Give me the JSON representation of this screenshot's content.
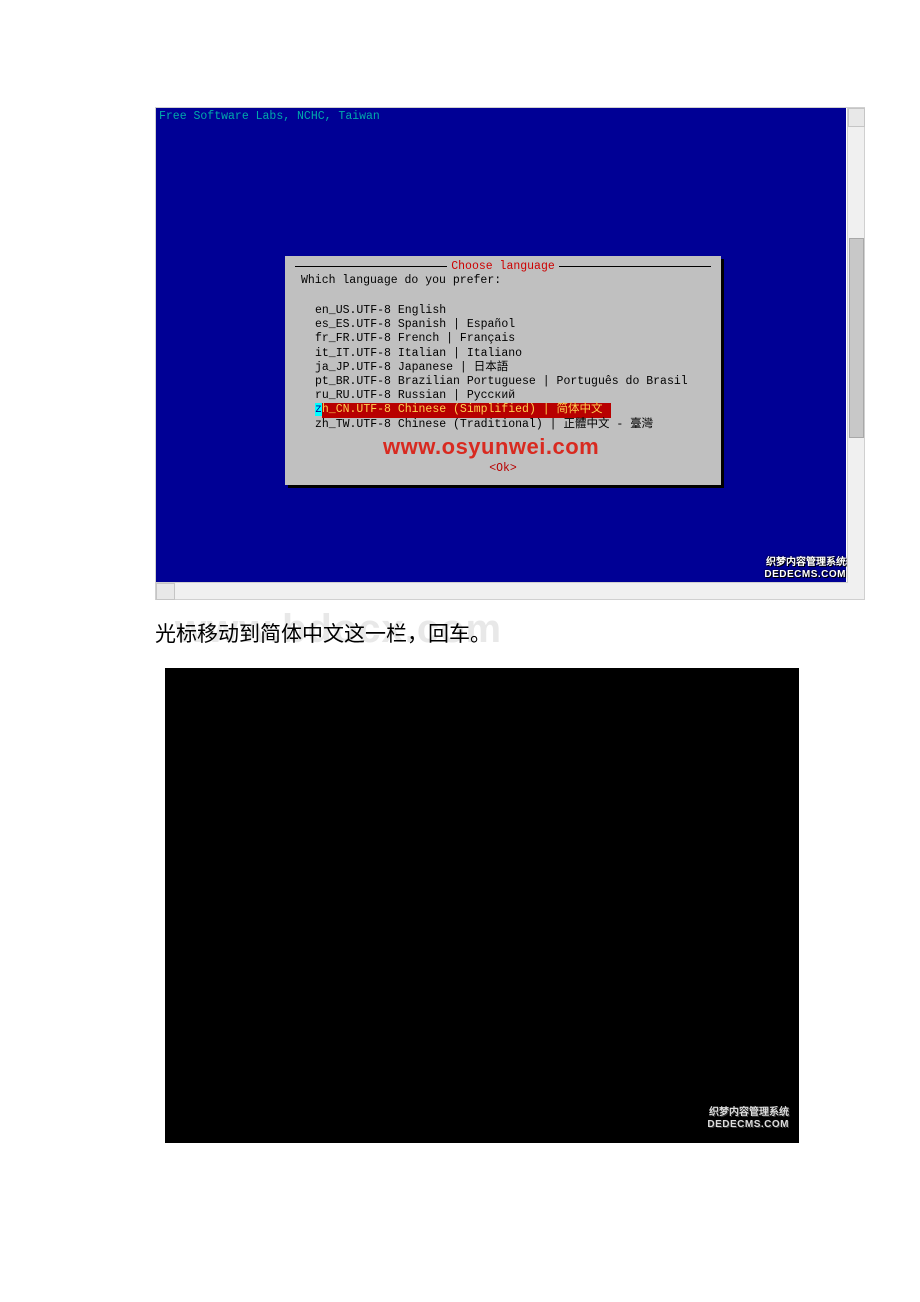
{
  "screenshot1": {
    "header": "Free Software Labs, NCHC, Taiwan",
    "dialog_title": "Choose language",
    "prompt": "Which language do you prefer:",
    "languages": [
      "en_US.UTF-8 English",
      "es_ES.UTF-8 Spanish | Español",
      "fr_FR.UTF-8 French | Français",
      "it_IT.UTF-8 Italian | Italiano",
      "ja_JP.UTF-8 Japanese | 日本語",
      "pt_BR.UTF-8 Brazilian Portuguese | Português do Brasil",
      "ru_RU.UTF-8 Russian | Русский",
      "zh_CN.UTF-8 Chinese (Simplified) | 简体中文",
      "zh_TW.UTF-8 Chinese (Traditional) | 正體中文 - 臺灣"
    ],
    "selected_index": 7,
    "watermark": "www.osyunwei.com",
    "ok": "<Ok>",
    "badge_cn": "织梦内容管理系统",
    "badge_en": "DEDECMS.COM"
  },
  "watermark_bg": "www.bdocx.com",
  "caption": "光标移动到简体中文这一栏，回车。",
  "screenshot2": {
    "badge_cn": "织梦内容管理系统",
    "badge_en": "DEDECMS.COM"
  }
}
